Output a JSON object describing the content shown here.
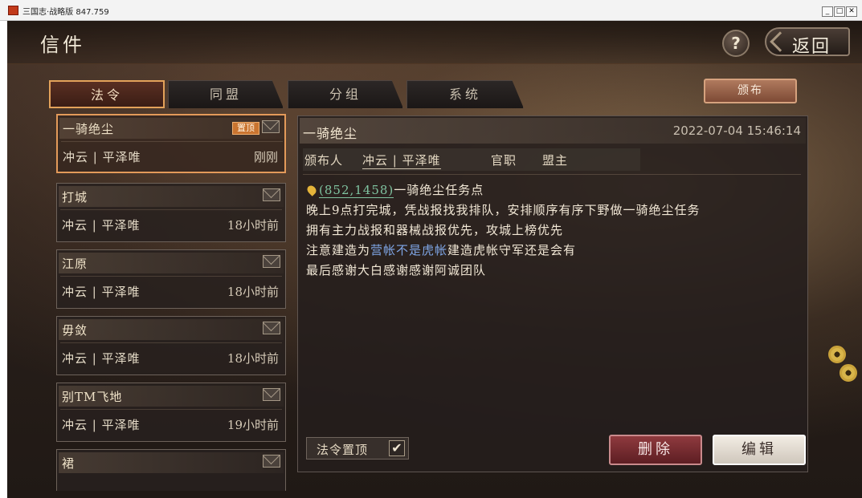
{
  "window": {
    "title": "三国志·战略版 847.759",
    "minimize": "_",
    "maximize": "□",
    "close": "✕"
  },
  "header": {
    "title": "信件",
    "help_label": "?",
    "back_label": "返回"
  },
  "tabs": [
    {
      "label": "法令",
      "active": true
    },
    {
      "label": "同盟",
      "active": false
    },
    {
      "label": "分组",
      "active": false
    },
    {
      "label": "系统",
      "active": false
    }
  ],
  "publish_label": "颁布",
  "mail_list": [
    {
      "subject": "一骑绝尘",
      "sender": "冲云 | 平泽唯",
      "time": "刚刚",
      "pinned": true,
      "pin_badge": "置顶",
      "selected": true
    },
    {
      "subject": "打城",
      "sender": "冲云 | 平泽唯",
      "time": "18小时前"
    },
    {
      "subject": "江原",
      "sender": "冲云 | 平泽唯",
      "time": "18小时前"
    },
    {
      "subject": "毋敛",
      "sender": "冲云 | 平泽唯",
      "time": "18小时前"
    },
    {
      "subject": "别TM飞地",
      "sender": "冲云 | 平泽唯",
      "time": "19小时前"
    },
    {
      "subject": "裙",
      "sender": "",
      "time": ""
    }
  ],
  "detail": {
    "subject": "一骑绝尘",
    "datetime": "2022-07-04 15:46:14",
    "publisher_label": "颁布人",
    "publisher_value": "冲云 | 平泽唯",
    "position_label": "官职",
    "position_value": "盟主",
    "coord_link": "(852,1458)",
    "line1_rest": "一骑绝尘任务点",
    "line2": "晚上9点打完城，凭战报找我排队，安排顺序有序下野做一骑绝尘任务",
    "line3": "拥有主力战报和器械战报优先，攻城上榜优先",
    "line4_pre": "注意建造为",
    "line4_highlight": "营帐不是虎帐",
    "line4_post": "建造虎帐守军还是会有",
    "line5": "最后感谢大白感谢感谢阿诚团队",
    "pin_toggle_label": "法令置顶",
    "pin_toggle_check": "✔",
    "delete_label": "删除",
    "edit_label": "编辑"
  },
  "colors": {
    "accent": "#e39a5a",
    "link": "#7fc3a0",
    "highlight": "#7fa6e6",
    "delete": "#8f3a3e"
  }
}
